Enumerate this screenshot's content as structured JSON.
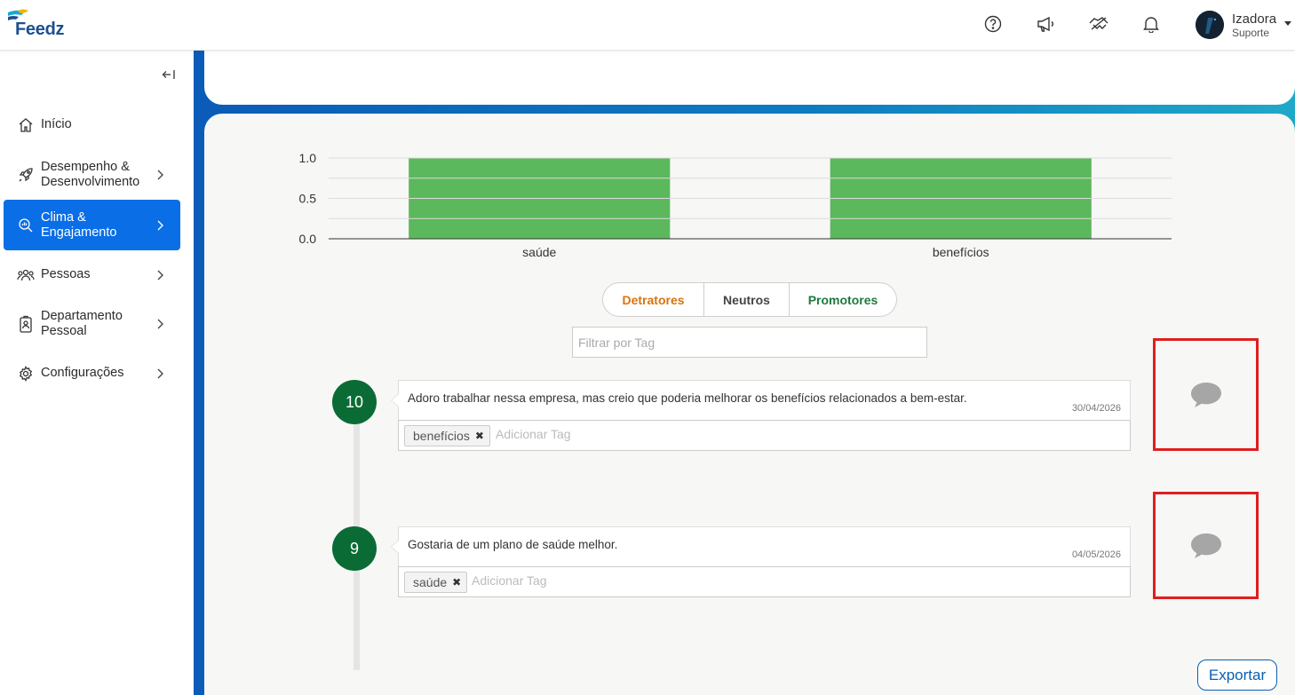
{
  "app": {
    "logo_text": "Feedz"
  },
  "header": {
    "icons": [
      "help-circle-icon",
      "megaphone-icon",
      "handshake-icon",
      "bell-icon"
    ],
    "user": {
      "name": "Izadora",
      "role": "Suporte"
    }
  },
  "sidebar": {
    "items": [
      {
        "label": "Início",
        "icon": "home-icon",
        "has_chevron": false,
        "active": false
      },
      {
        "label": "Desempenho &\nDesenvolvimento",
        "icon": "rocket-icon",
        "has_chevron": true,
        "active": false
      },
      {
        "label": "Clima &\nEngajamento",
        "icon": "search-chart-icon",
        "has_chevron": true,
        "active": true
      },
      {
        "label": "Pessoas",
        "icon": "people-icon",
        "has_chevron": true,
        "active": false
      },
      {
        "label": "Departamento\nPessoal",
        "icon": "badge-icon",
        "has_chevron": true,
        "active": false
      },
      {
        "label": "Configurações",
        "icon": "gear-icon",
        "has_chevron": true,
        "active": false
      }
    ]
  },
  "chart_data": {
    "type": "bar",
    "categories": [
      "saúde",
      "benefícios"
    ],
    "values": [
      1.0,
      1.0
    ],
    "ylim": [
      0,
      1.0
    ],
    "yticks": [
      "0.0",
      "0.5",
      "1.0"
    ],
    "bar_color": "#5cb85c",
    "grid": true
  },
  "filters": {
    "segments": [
      {
        "label": "Detratores",
        "color": "#d9730d"
      },
      {
        "label": "Neutros",
        "color": "#444444"
      },
      {
        "label": "Promotores",
        "color": "#1e7a3c"
      }
    ],
    "tag_placeholder": "Filtrar por Tag"
  },
  "comments": [
    {
      "score": "10",
      "text": "Adoro trabalhar nessa empresa, mas creio que poderia melhorar os benefícios relacionados a bem-estar.",
      "date": "30/04/2026",
      "tag": "benefícios",
      "tag_placeholder": "Adicionar Tag"
    },
    {
      "score": "9",
      "text": "Gostaria de um plano de saúde melhor.",
      "date": "04/05/2026",
      "tag": "saúde",
      "tag_placeholder": "Adicionar Tag"
    }
  ],
  "export_label": "Exportar"
}
